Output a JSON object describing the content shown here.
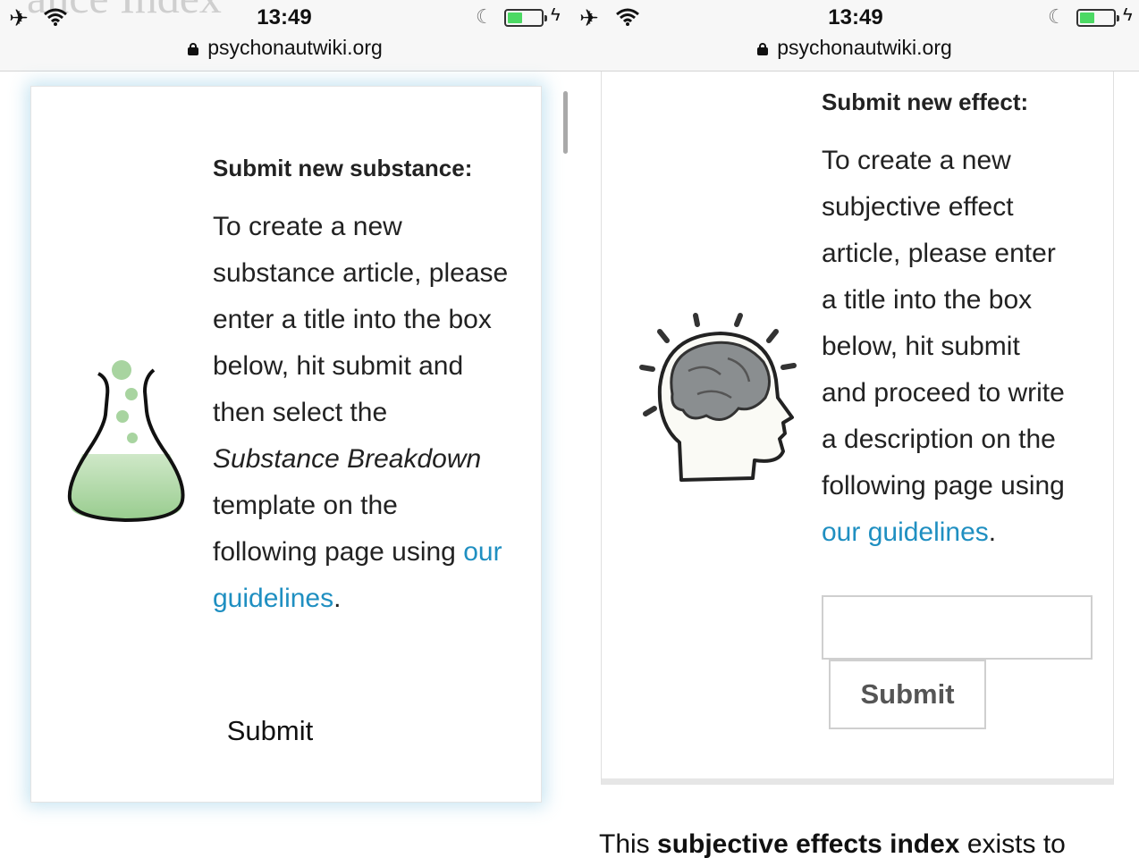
{
  "left_screen": {
    "status_bar": {
      "background_title": "ance Index",
      "time": "13:49",
      "url": "psychonautwiki.org",
      "icons": [
        "airplane-icon",
        "wifi-icon",
        "moon-icon",
        "battery-icon",
        "charging-icon",
        "lock-icon"
      ]
    },
    "card": {
      "icon": "flask-icon",
      "heading": "Submit new substance:",
      "lines": [
        "To create a new",
        "substance article, please",
        "enter a title into the box",
        "below, hit submit and",
        "then select the"
      ],
      "italic_line": "Substance Breakdown",
      "line_after_italic": "template on the",
      "pre_link_text": "following page using ",
      "link_part1": "our",
      "link_part2": "guidelines",
      "trailing_period": ".",
      "submit_label": "Submit"
    }
  },
  "right_screen": {
    "status_bar": {
      "time": "13:49",
      "url": "psychonautwiki.org",
      "icons": [
        "airplane-icon",
        "wifi-icon",
        "moon-icon",
        "battery-icon",
        "charging-icon",
        "lock-icon"
      ]
    },
    "card": {
      "icon": "head-brain-icon",
      "heading": "Submit new effect:",
      "lines": [
        "To create a new",
        "subjective effect",
        "article, please enter",
        "a title into the box",
        "below, hit submit",
        "and proceed to write",
        "a description on the",
        "following page using"
      ],
      "link": "our guidelines",
      "trailing_period": ".",
      "input_value": "",
      "submit_label": "Submit"
    },
    "footer": {
      "prefix": "This ",
      "bold": "subjective effects index",
      "suffix": " exists to"
    }
  },
  "colors": {
    "link": "#1f8fc1",
    "battery": "#4cd964",
    "card_glow": "#82c3e1",
    "flask_liquid": "#a8d4a0"
  }
}
